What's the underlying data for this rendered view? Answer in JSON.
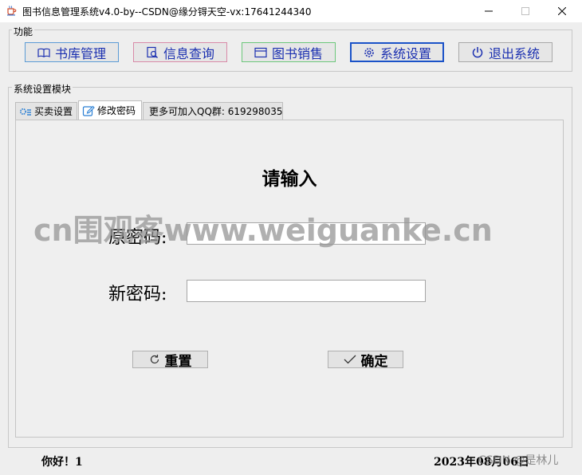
{
  "window": {
    "title": "图书信息管理系统v4.0-by--CSDN@缘分锝天空-vx:17641244340",
    "icon": "java-cup-icon"
  },
  "function_group": {
    "label": "功能",
    "buttons": [
      {
        "label": "书库管理",
        "icon": "book-icon",
        "color": "#5b9bd5"
      },
      {
        "label": "信息查询",
        "icon": "search-doc-icon",
        "color": "#d98aa8"
      },
      {
        "label": "图书销售",
        "icon": "window-icon",
        "color": "#6cc77b"
      },
      {
        "label": "系统设置",
        "icon": "gear-icon",
        "color": "#1a52c8"
      },
      {
        "label": "退出系统",
        "icon": "power-icon",
        "color": "#a8a8a8"
      }
    ]
  },
  "settings_group": {
    "label": "系统设置模块",
    "tabs": [
      {
        "label": "买卖设置",
        "icon": "gears-icon",
        "active": false
      },
      {
        "label": "修改密码",
        "icon": "edit-icon",
        "active": true
      },
      {
        "label": "更多可加入QQ群: 619298035",
        "icon": "phone-icon",
        "active": false
      }
    ]
  },
  "form": {
    "heading": "请输入",
    "old_password_label": "原密码:",
    "old_password_value": "",
    "new_password_label": "新密码:",
    "new_password_value": "",
    "reset_label": "重置",
    "confirm_label": "确定"
  },
  "watermark": "cn围观客www.weiguanke.cn",
  "status": {
    "greeting": "你好！1",
    "date": "2023年08月06日",
    "csdn_watermark": "CSDN @是林儿"
  }
}
